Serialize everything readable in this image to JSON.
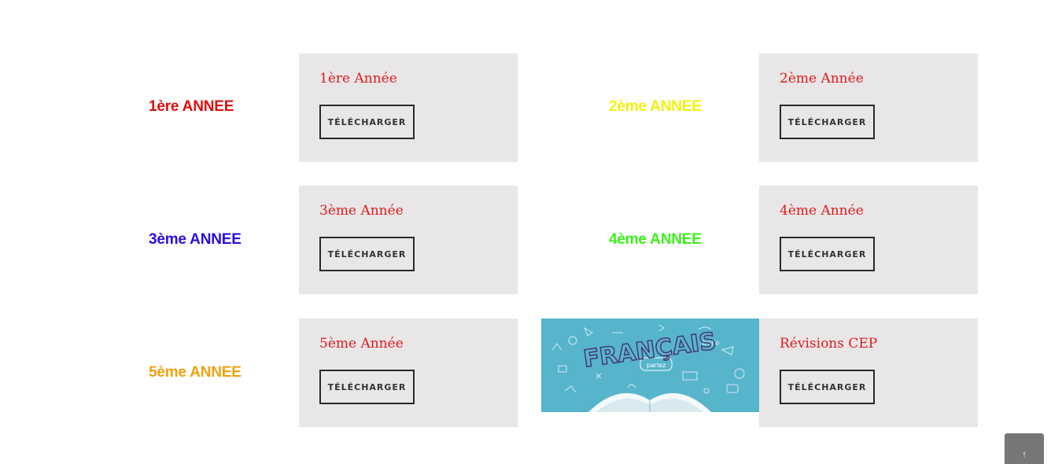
{
  "colors": {
    "card_bg": "#e8e6e7",
    "card_title": "#dd1c1c",
    "button_border": "#2a2a2a",
    "image_bg": "#56b5cb",
    "scroll_top_bg": "#777777"
  },
  "rows": [
    {
      "left_label": {
        "text": "1ère ANNEE",
        "color": "#e00d0d"
      },
      "left_card": {
        "title": "1ère Année",
        "button": "TÉLÉCHARGER"
      },
      "right_label": {
        "text": "2ème ANNEE",
        "color": "#f2f20a"
      },
      "right_card": {
        "title": "2ème Année",
        "button": "TÉLÉCHARGER"
      }
    },
    {
      "left_label": {
        "text": "3ème ANNEE",
        "color": "#2a0de0"
      },
      "left_card": {
        "title": "3ème Année",
        "button": "TÉLÉCHARGER"
      },
      "right_label": {
        "text": "4ème ANNEE",
        "color": "#3af21a"
      },
      "right_card": {
        "title": "4ème Année",
        "button": "TÉLÉCHARGER"
      }
    },
    {
      "left_label": {
        "text": "5ème ANNEE",
        "color": "#f0a20f"
      },
      "left_card": {
        "title": "5ème Année",
        "button": "TÉLÉCHARGER"
      },
      "right_image": {
        "text": "FRANÇAIS",
        "bubble": "parlez",
        "icon": "open-book-illustration"
      },
      "right_card": {
        "title": "Révisions CEP",
        "button": "TÉLÉCHARGER"
      }
    }
  ],
  "scroll_top": {
    "icon": "arrow-up-icon",
    "glyph": "↑"
  }
}
